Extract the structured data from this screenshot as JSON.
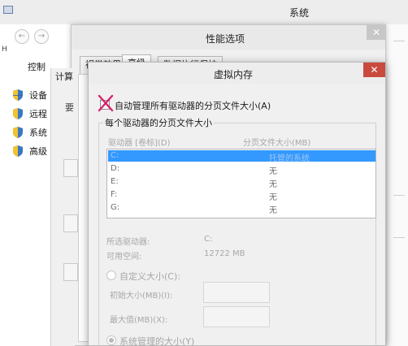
{
  "system_window": {
    "title": "系统",
    "left_heading": "H",
    "control_panel_label": "控制",
    "links": [
      {
        "label": "设备",
        "icon": "shield-icon"
      },
      {
        "label": "远程",
        "icon": "shield-icon"
      },
      {
        "label": "系统",
        "icon": "shield-icon"
      },
      {
        "label": "高级",
        "icon": "shield-icon"
      }
    ],
    "nav": {
      "back": "←",
      "forward": "→"
    },
    "peek_tab": "计算",
    "peek_text": "要"
  },
  "performance_dialog": {
    "title": "性能选项",
    "close_glyph": "✕",
    "tabs": [
      "视觉效果",
      "高级",
      "数据执行保护"
    ],
    "active_tab": "高级"
  },
  "virtual_memory_dialog": {
    "title": "虚拟内存",
    "close_glyph": "✕",
    "auto_manage_label": "自动管理所有驱动器的分页文件大小(A)",
    "auto_manage_checked": false,
    "group_label": "每个驱动器的分页文件大小",
    "columns": {
      "drive": "驱动器 [卷标](D)",
      "size": "分页文件大小(MB)"
    },
    "drives": [
      {
        "letter": "C:",
        "size": "托管的系统",
        "selected": true
      },
      {
        "letter": "D:",
        "size": "无",
        "selected": false
      },
      {
        "letter": "E:",
        "size": "无",
        "selected": false
      },
      {
        "letter": "F:",
        "size": "无",
        "selected": false
      },
      {
        "letter": "G:",
        "size": "无",
        "selected": false
      }
    ],
    "selected_drive_label": "所选驱动器:",
    "selected_drive_value": "C:",
    "free_space_label": "可用空间:",
    "free_space_value": "12722 MB",
    "custom_size_label": "自定义大小(C):",
    "initial_size_label": "初始大小(MB)(I):",
    "max_size_label": "最大值(MB)(X):",
    "system_managed_label": "系统管理的大小(Y)",
    "custom_selected": false,
    "system_managed_selected": true
  },
  "colors": {
    "selection": "#3399ff",
    "close_red": "#c84a3d",
    "annotation_magenta": "#d4246e",
    "disabled_text": "#a7a7a7"
  }
}
